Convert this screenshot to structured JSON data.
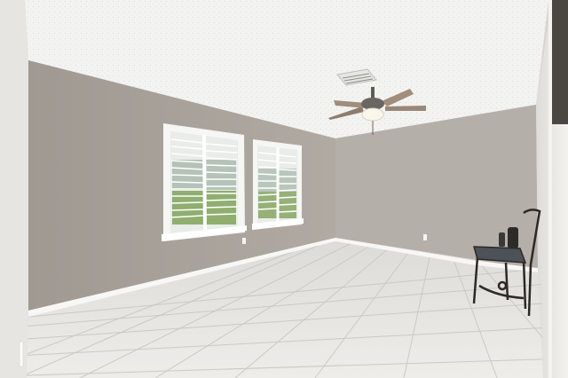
{
  "scene": {
    "kind": "empty-room-interior",
    "elements": [
      "textured-ceiling",
      "hvac-vent",
      "ceiling-fan",
      "fan-light",
      "window-left",
      "window-right",
      "plantation-shutters",
      "tile-floor",
      "baseboards",
      "wall-outlets",
      "side-chair",
      "kettle",
      "mug",
      "door-frame"
    ]
  },
  "colors": {
    "ceiling": "#f4f4f2",
    "wall_left": "#a9a39c",
    "wall_back": "#b3aea8",
    "wall_right": "#ecebe8",
    "floor": "#e3e2df",
    "floor_grout": "#cfcdc9",
    "trim": "#f7f7f5",
    "shutter": "#fbfbfb",
    "lawn": "#7fa35a",
    "fan_blade": "#9a8878",
    "fan_metal": "#5f5c58",
    "chair": "#3a3230",
    "chair_seat": "#4c5257"
  }
}
